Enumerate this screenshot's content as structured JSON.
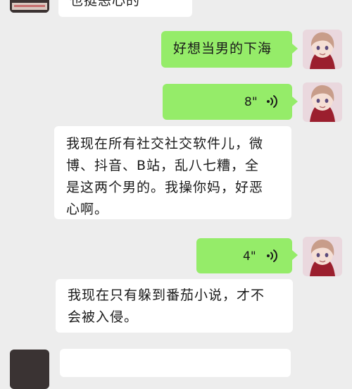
{
  "conversation": {
    "messages": [
      {
        "direction": "incoming",
        "type": "text",
        "text": "也挺恶心的"
      },
      {
        "direction": "outgoing",
        "type": "text",
        "text": "好想当男的下海"
      },
      {
        "direction": "outgoing",
        "type": "voice",
        "duration": "8\""
      },
      {
        "direction": "incoming",
        "type": "text",
        "lines": [
          "我现在所有社交社交软件儿，微",
          "博、抖音、B站，乱八七糟，全",
          "是这两个男的。我操你妈，好恶",
          "心啊。"
        ]
      },
      {
        "direction": "outgoing",
        "type": "voice",
        "duration": "4\""
      },
      {
        "direction": "incoming",
        "type": "text",
        "lines": [
          "我现在只有躲到番茄小说，才不",
          "会被入侵。"
        ]
      }
    ]
  },
  "colors": {
    "background": "#ededed",
    "outgoing_bubble": "#95ec69",
    "incoming_bubble": "#ffffff"
  },
  "icons": {
    "voice": "voice-wave-icon",
    "sender_avatar": "anime-girl-avatar",
    "contact_avatar": "contact-avatar"
  }
}
